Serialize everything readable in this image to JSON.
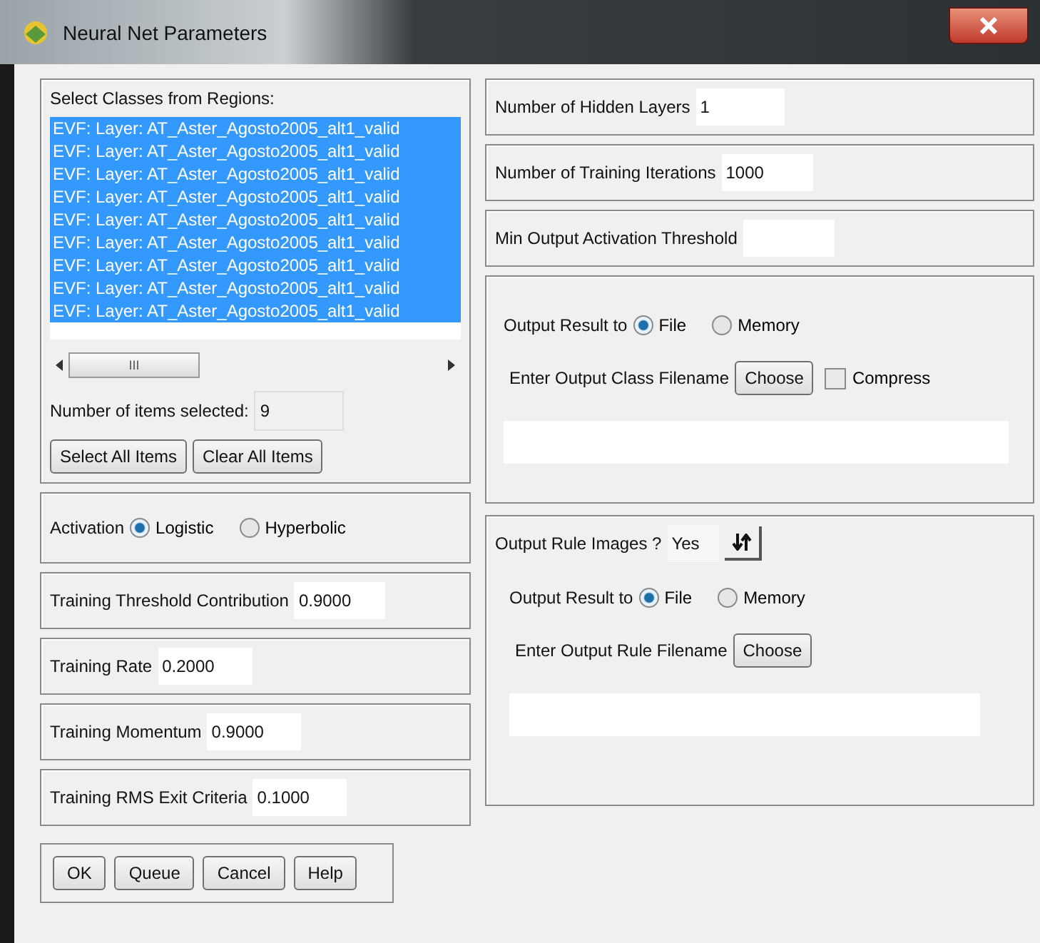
{
  "window": {
    "title": "Neural Net Parameters"
  },
  "classes": {
    "label": "Select Classes from Regions:",
    "items": [
      {
        "text": "EVF: Layer: AT_Aster_Agosto2005_alt1_valid",
        "selected": true
      },
      {
        "text": "EVF: Layer: AT_Aster_Agosto2005_alt1_valid",
        "selected": true
      },
      {
        "text": "EVF: Layer: AT_Aster_Agosto2005_alt1_valid",
        "selected": true
      },
      {
        "text": "EVF: Layer: AT_Aster_Agosto2005_alt1_valid",
        "selected": true
      },
      {
        "text": "EVF: Layer: AT_Aster_Agosto2005_alt1_valid",
        "selected": true
      },
      {
        "text": "EVF: Layer: AT_Aster_Agosto2005_alt1_valid",
        "selected": true
      },
      {
        "text": "EVF: Layer: AT_Aster_Agosto2005_alt1_valid",
        "selected": true
      },
      {
        "text": "EVF: Layer: AT_Aster_Agosto2005_alt1_valid",
        "selected": true
      },
      {
        "text": "EVF: Layer: AT_Aster_Agosto2005_alt1_valid",
        "selected": true
      }
    ],
    "scroll_grip": "III",
    "count_label": "Number of items selected:",
    "count": "9",
    "buttons": [
      "Select All Items",
      "Clear All Items"
    ]
  },
  "activation": {
    "label": "Activation",
    "options": [
      {
        "label": "Logistic",
        "selected": true
      },
      {
        "label": "Hyperbolic",
        "selected": false
      }
    ]
  },
  "left_fields": [
    {
      "label": "Training Threshold Contribution",
      "value": "0.9000"
    },
    {
      "label": "Training Rate",
      "value": "0.2000"
    },
    {
      "label": "Training Momentum",
      "value": "0.9000"
    },
    {
      "label": "Training RMS Exit Criteria",
      "value": "0.1000"
    }
  ],
  "right_fields": [
    {
      "label": "Number of Hidden Layers",
      "value": "1"
    },
    {
      "label": "Number of Training Iterations",
      "value": "1000"
    },
    {
      "label": "Min Output Activation Threshold"
    }
  ],
  "class_output": {
    "label": "Output Result to",
    "options": [
      {
        "label": "File",
        "selected": true
      },
      {
        "label": "Memory",
        "selected": false
      }
    ],
    "filename_label": "Enter Output Class Filename",
    "choose": "Choose",
    "compress": {
      "label": "Compress",
      "checked": false
    }
  },
  "rule_output": {
    "label": "Output Rule Images ?",
    "value": "Yes",
    "result_label": "Output Result to",
    "options": [
      {
        "label": "File",
        "selected": true
      },
      {
        "label": "Memory",
        "selected": false
      }
    ],
    "filename_label": "Enter Output Rule Filename",
    "choose": "Choose"
  },
  "buttons": [
    "OK",
    "Queue",
    "Cancel",
    "Help"
  ]
}
